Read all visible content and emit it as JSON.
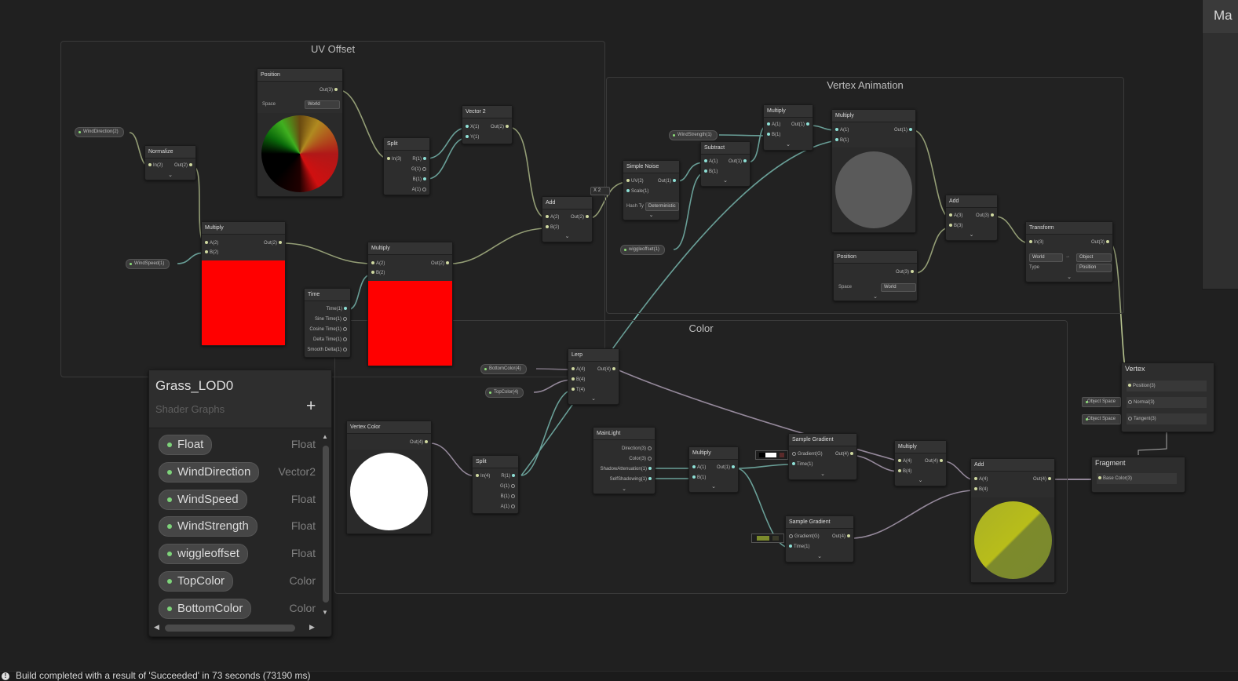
{
  "groups": {
    "uv_offset": "UV Offset",
    "vertex_animation": "Vertex Animation",
    "color": "Color"
  },
  "properties_on_graph": {
    "wind_direction": "WindDirection(2)",
    "wind_speed": "WindSpeed(1)",
    "wind_strength": "WindStrength(1)",
    "wiggleoffset": "wiggleoffset(1)",
    "bottom_color": "BottomColor(4)",
    "top_color": "TopColor(4)",
    "object_space_normal": "Object Space",
    "object_space_tangent": "Object Space"
  },
  "nodes": {
    "position_uv": {
      "title": "Position",
      "out": "Out(3)",
      "space_label": "Space",
      "space_value": "World"
    },
    "normalize": {
      "title": "Normalize",
      "in": "In(2)",
      "out": "Out(2)"
    },
    "split_uv": {
      "title": "Split",
      "in": "In(3)",
      "r": "R(1)",
      "g": "G(1)",
      "b": "B(1)",
      "a": "A(1)"
    },
    "vector2": {
      "title": "Vector 2",
      "x": "X(1)",
      "y": "Y(1)",
      "out": "Out(2)"
    },
    "multiply_uv1": {
      "title": "Multiply",
      "a": "A(2)",
      "b": "B(2)",
      "out": "Out(2)"
    },
    "multiply_uv2": {
      "title": "Multiply",
      "a": "A(2)",
      "b": "B(2)",
      "out": "Out(2)"
    },
    "time": {
      "title": "Time",
      "time": "Time(1)",
      "sine": "Sine Time(1)",
      "cosine": "Cosine Time(1)",
      "delta": "Delta Time(1)",
      "smooth": "Smooth Delta(1)"
    },
    "add_uv": {
      "title": "Add",
      "a": "A(2)",
      "b": "B(2)",
      "out": "Out(2)"
    },
    "scale_value": {
      "x": "X",
      "value": "2"
    },
    "simple_noise": {
      "title": "Simple Noise",
      "uv": "UV(2)",
      "scale": "Scale(1)",
      "out": "Out(1)",
      "hash_label": "Hash Ty",
      "hash_value": "Deterministic"
    },
    "subtract": {
      "title": "Subtract",
      "a": "A(1)",
      "b": "B(1)",
      "out": "Out(1)"
    },
    "multiply_va1": {
      "title": "Multiply",
      "a": "A(1)",
      "b": "B(1)",
      "out": "Out(1)"
    },
    "multiply_va2": {
      "title": "Multiply",
      "a": "A(1)",
      "b": "B(1)",
      "out": "Out(1)"
    },
    "position_va": {
      "title": "Position",
      "out": "Out(3)",
      "space_label": "Space",
      "space_value": "World"
    },
    "add_va": {
      "title": "Add",
      "a": "A(3)",
      "b": "B(3)",
      "out": "Out(3)"
    },
    "transform": {
      "title": "Transform",
      "in": "In(3)",
      "out": "Out(3)",
      "from": "World",
      "arrow": "→",
      "to": "Object",
      "type_label": "Type",
      "type_value": "Position"
    },
    "lerp": {
      "title": "Lerp",
      "a": "A(4)",
      "b": "B(4)",
      "t": "T(4)",
      "out": "Out(4)"
    },
    "vertex_color": {
      "title": "Vertex Color",
      "out": "Out(4)"
    },
    "split_color": {
      "title": "Split",
      "in": "In(4)",
      "r": "R(1)",
      "g": "G(1)",
      "b": "B(1)",
      "a": "A(1)"
    },
    "main_light": {
      "title": "MainLight",
      "direction": "Direction(3)",
      "color": "Color(3)",
      "shadow": "ShadowAttenuation(1)",
      "self": "SelfShadowing(1)"
    },
    "multiply_c1": {
      "title": "Multiply",
      "a": "A(1)",
      "b": "B(1)",
      "out": "Out(1)"
    },
    "sample_gradient1": {
      "title": "Sample Gradient",
      "gradient": "Gradient(G)",
      "time": "Time(1)",
      "out": "Out(4)"
    },
    "sample_gradient2": {
      "title": "Sample Gradient",
      "gradient": "Gradient(G)",
      "time": "Time(1)",
      "out": "Out(4)"
    },
    "multiply_c2": {
      "title": "Multiply",
      "a": "A(4)",
      "b": "B(4)",
      "out": "Out(4)"
    },
    "add_c": {
      "title": "Add",
      "a": "A(4)",
      "b": "B(4)",
      "out": "Out(4)"
    },
    "vertex_master": {
      "title": "Vertex",
      "position": "Position(3)",
      "normal": "Normal(3)",
      "tangent": "Tangent(3)"
    },
    "fragment_master": {
      "title": "Fragment",
      "base_color": "Base Color(3)"
    }
  },
  "blackboard": {
    "title": "Grass_LOD0",
    "subtitle": "Shader Graphs",
    "add_label": "+",
    "properties": [
      {
        "name": "Float",
        "type": "Float"
      },
      {
        "name": "WindDirection",
        "type": "Vector2"
      },
      {
        "name": "WindSpeed",
        "type": "Float"
      },
      {
        "name": "WindStrength",
        "type": "Float"
      },
      {
        "name": "wiggleoffset",
        "type": "Float"
      },
      {
        "name": "TopColor",
        "type": "Color"
      },
      {
        "name": "BottomColor",
        "type": "Color"
      }
    ]
  },
  "master_preview": {
    "title": "Ma"
  },
  "status": {
    "text": "Build completed with a result of 'Succeeded' in 73 seconds (73190 ms)"
  },
  "colors": {
    "wire_vector": "#c8cf94",
    "wire_float": "#7fc7bd",
    "wire_color": "#b8a8c0",
    "accent_green": "#7ed37a"
  }
}
